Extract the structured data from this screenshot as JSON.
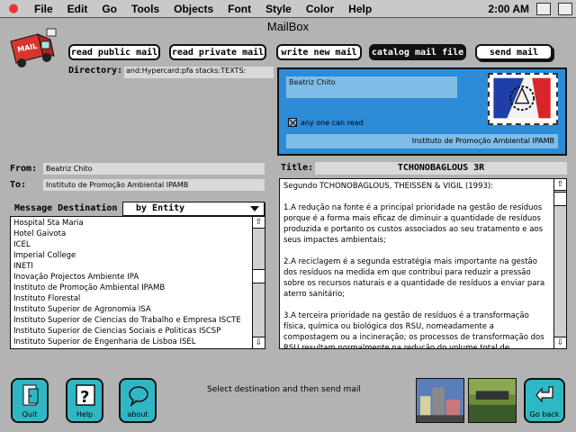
{
  "menubar": {
    "items": [
      "File",
      "Edit",
      "Go",
      "Tools",
      "Objects",
      "Font",
      "Style",
      "Color",
      "Help"
    ],
    "clock": "2:00 AM"
  },
  "app_title": "MailBox",
  "toolbar": {
    "read_public": "read public mail",
    "read_private": "read private mail",
    "write_new": "write new mail",
    "catalog": "catalog mail file",
    "send": "send mail"
  },
  "directory": {
    "label": "Directory:",
    "value": "and:Hypercard:pfa stacks:TEXTS:"
  },
  "panel": {
    "sender_name": "Beatriz Chito",
    "checkbox_label": "any one can read",
    "checkbox_checked": true,
    "institution": "Instituto de Promoção Ambiental IPAMB"
  },
  "from": {
    "label": "From:",
    "value": "Beatriz Chito"
  },
  "to": {
    "label": "To:",
    "value": "Instituto de Promoção Ambiental IPAMB"
  },
  "title": {
    "label": "Title:",
    "value": "TCHONOBAGLOUS 3R"
  },
  "destination": {
    "label": "Message Destination",
    "mode": "by Entity",
    "items": [
      "Hospital Sta Maria",
      "Hotel Gaivota",
      "ICEL",
      "Imperial College",
      "INETI",
      "Inovação Projectos Ambiente IPA",
      "Instituto de Promoção Ambiental IPAMB",
      "Instituto Florestal",
      "Instituto Superior de Agronomia ISA",
      "Instituto Superior de Ciencias do Trabalho e Empresa ISCTE",
      "Instituto Superior de Ciencias Sociais e Politicas ISCSP",
      "Instituto Superior de Engenharia de Lisboa ISEL"
    ]
  },
  "message": {
    "body": "Segundo TCHONOBAGLOUS, THEISSEN & VIGIL (1993):\n\n1.A redução na fonte é a principal prioridade na gestão de resíduos porque é a forma mais eficaz de diminuir a quantidade de resíduos produzida e portanto os custos associados ao seu tratamento e aos seus impactes ambientais;\n\n2.A reciclagem é a segunda estratégia mais importante na gestão dos resíduos na medida em que contribui para reduzir a pressão sobre os recursos naturais e a quantidade de resíduos a enviar para aterro sanitário;\n\n3.A terceira prioridade na gestão de resíduos é a transformação física, química ou biológica dos RSU, nomeadamente a compostagem ou a incineração; os processos de transformação dos RSU resultam normalmente na redução do volume total de"
  },
  "status": "Select destination and then send mail",
  "bottom": {
    "quit": "Quit",
    "help": "Help",
    "about": "about",
    "go_back": "Go back"
  },
  "colors": {
    "background": "#b3b3b3",
    "panel_blue": "#2d8bd8",
    "panel_field": "#7fbde6",
    "button_teal": "#2fb8c4"
  }
}
